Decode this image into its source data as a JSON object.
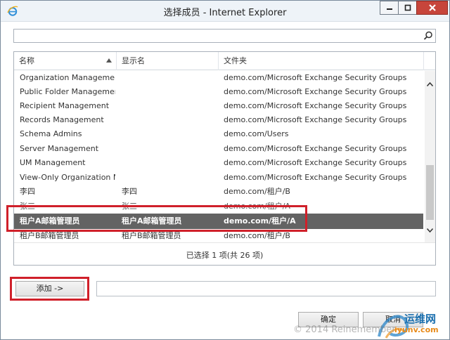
{
  "window": {
    "title": "选择成员 - Internet Explorer"
  },
  "search": {
    "value": "",
    "placeholder": ""
  },
  "list": {
    "columns": [
      {
        "label": "名称"
      },
      {
        "label": "显示名"
      },
      {
        "label": "文件夹"
      }
    ],
    "rows": [
      {
        "name": "Organization Management",
        "display": "",
        "folder": "demo.com/Microsoft Exchange Security Groups"
      },
      {
        "name": "Public Folder Management",
        "display": "",
        "folder": "demo.com/Microsoft Exchange Security Groups"
      },
      {
        "name": "Recipient Management",
        "display": "",
        "folder": "demo.com/Microsoft Exchange Security Groups"
      },
      {
        "name": "Records Management",
        "display": "",
        "folder": "demo.com/Microsoft Exchange Security Groups"
      },
      {
        "name": "Schema Admins",
        "display": "",
        "folder": "demo.com/Users"
      },
      {
        "name": "Server Management",
        "display": "",
        "folder": "demo.com/Microsoft Exchange Security Groups"
      },
      {
        "name": "UM Management",
        "display": "",
        "folder": "demo.com/Microsoft Exchange Security Groups"
      },
      {
        "name": "View-Only Organization M...",
        "display": "",
        "folder": "demo.com/Microsoft Exchange Security Groups"
      },
      {
        "name": "李四",
        "display": "李四",
        "folder": "demo.com/租户/B"
      },
      {
        "name": "张三",
        "display": "张三",
        "folder": "demo.com/租户/A"
      },
      {
        "name": "租户A邮箱管理员",
        "display": "租户A邮箱管理员",
        "folder": "demo.com/租户/A"
      },
      {
        "name": "租户B邮箱管理员",
        "display": "租户B邮箱管理员",
        "folder": "demo.com/租户/B"
      }
    ],
    "status": "已选择 1 项(共 26 项)"
  },
  "actions": {
    "add_label": "添加 ->",
    "added_value": "",
    "ok_label": "确定",
    "cancel_label": "取消"
  },
  "watermark": {
    "copyright": "© 2014 Reinemember",
    "brand": "运维网",
    "site": "iyunv.com"
  }
}
